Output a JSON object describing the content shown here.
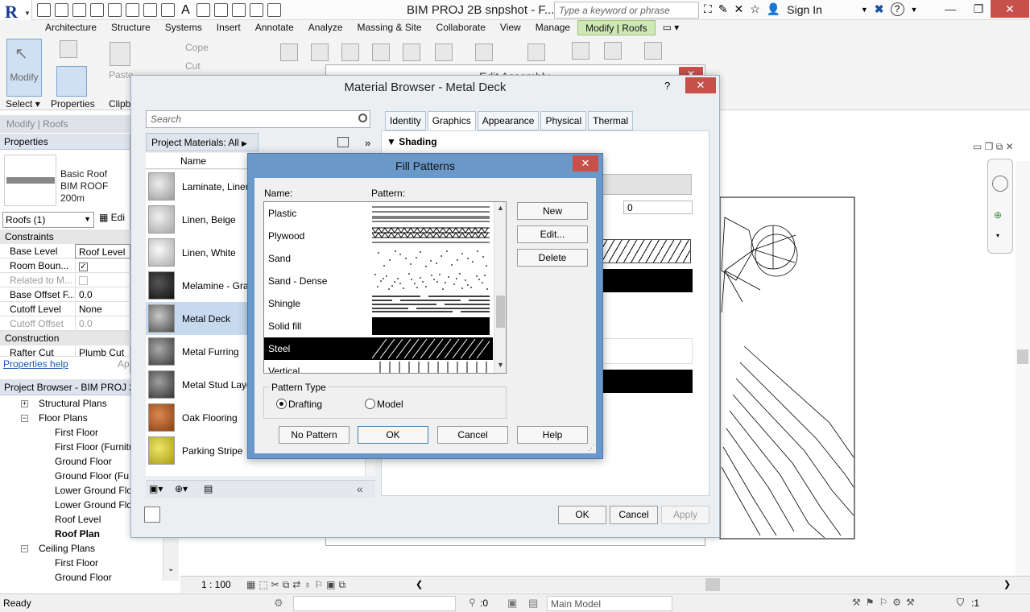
{
  "app": {
    "title": "BIM PROJ 2B snpshot - F...",
    "search_placeholder": "Type a keyword or phrase",
    "sign_in": "Sign In",
    "help_icon": "question-icon"
  },
  "ribbon_tabs": [
    "Architecture",
    "Structure",
    "Systems",
    "Insert",
    "Annotate",
    "Analyze",
    "Massing & Site",
    "Collaborate",
    "View",
    "Manage",
    "Modify | Roofs"
  ],
  "ribbon": {
    "modify": "Modify",
    "select": "Select",
    "properties": "Properties",
    "clipboard": "Clipb",
    "paste": "Paste",
    "cope": "Cope",
    "cut": "Cut"
  },
  "context_bar": "Modify | Roofs",
  "properties": {
    "header": "Properties",
    "type_name_1": "Basic Roof",
    "type_name_2": "BIM ROOF 200m",
    "instance_selector": "Roofs (1)",
    "edit_type": "Edi",
    "sections": {
      "constraints": "Constraints",
      "construction": "Construction"
    },
    "rows": [
      {
        "key": "Base Level",
        "value": "Roof Level"
      },
      {
        "key": "Room Boun...",
        "value": ""
      },
      {
        "key": "Related to M...",
        "value": ""
      },
      {
        "key": "Base Offset F...",
        "value": "0.0"
      },
      {
        "key": "Cutoff Level",
        "value": "None"
      },
      {
        "key": "Cutoff Offset",
        "value": "0.0"
      },
      {
        "key": "Rafter Cut",
        "value": "Plumb Cut"
      }
    ],
    "help_link": "Properties help",
    "apply": "Ap"
  },
  "project_browser": {
    "header": "Project Browser - BIM PROJ 2B",
    "items": [
      "Structural Plans",
      "Floor Plans",
      "First Floor",
      "First Floor (Furnitu",
      "Ground  Floor",
      "Ground  Floor  (Fu",
      "Lower Ground Flo",
      "Lower Ground Flo",
      "Roof Level",
      "Roof Plan",
      "Ceiling Plans",
      "First Floor",
      "Ground  Floor"
    ]
  },
  "view_control": {
    "scale": "1 : 100"
  },
  "status": {
    "ready": "Ready",
    "workset_count": ":0",
    "design_option": "Main Model",
    "filter": ":1"
  },
  "edit_assembly": {
    "title": "Edit Assembly"
  },
  "material_browser": {
    "title": "Material Browser - Metal Deck",
    "help": "?",
    "search_placeholder": "Search",
    "project_materials": "Project Materials: All",
    "col_name": "Name",
    "materials": [
      {
        "name": "Laminate, Liner",
        "color": "#c9c9c9"
      },
      {
        "name": "Linen, Beige",
        "color": "#cfcfcf"
      },
      {
        "name": "Linen, White",
        "color": "#d6d6d6"
      },
      {
        "name": "Melamine - Gra",
        "color": "#2a2a2a"
      },
      {
        "name": "Metal Deck",
        "color": "#8a8a8a"
      },
      {
        "name": "Metal Furring",
        "color": "#7a7a7a"
      },
      {
        "name": "Metal Stud Laye",
        "color": "#6f6f6f"
      },
      {
        "name": "Oak Flooring",
        "color": "#b5652a"
      },
      {
        "name": "Parking Stripe",
        "color": "#d6cc3a"
      }
    ],
    "selected_material": "Metal Deck",
    "tabs": [
      "Identity",
      "Graphics",
      "Appearance",
      "Physical",
      "Thermal"
    ],
    "active_tab": "Graphics",
    "section_shading": "Shading",
    "transparency_value": "0",
    "buttons": {
      "ok": "OK",
      "cancel": "Cancel",
      "apply": "Apply"
    }
  },
  "fill_patterns": {
    "title": "Fill Patterns",
    "col_name": "Name:",
    "col_pattern": "Pattern:",
    "patterns": [
      {
        "name": "Plastic",
        "kind": "lines"
      },
      {
        "name": "Plywood",
        "kind": "plywood"
      },
      {
        "name": "Sand",
        "kind": "dots"
      },
      {
        "name": "Sand - Dense",
        "kind": "dense-dots"
      },
      {
        "name": "Shingle",
        "kind": "shingle"
      },
      {
        "name": "Solid fill",
        "kind": "solid"
      },
      {
        "name": "Steel",
        "kind": "diagonal"
      },
      {
        "name": "Vertical",
        "kind": "vertical"
      }
    ],
    "selected": "Steel",
    "buttons": {
      "new": "New",
      "edit": "Edit...",
      "delete": "Delete",
      "no_pattern": "No Pattern",
      "ok": "OK",
      "cancel": "Cancel",
      "help": "Help"
    },
    "pattern_type_label": "Pattern Type",
    "pattern_type_options": [
      "Drafting",
      "Model"
    ],
    "pattern_type_selected": "Drafting"
  }
}
